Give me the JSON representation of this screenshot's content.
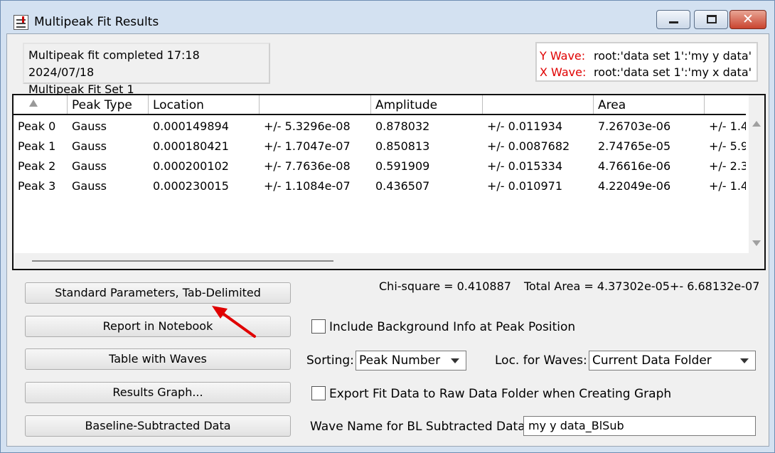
{
  "window": {
    "title": "Multipeak Fit Results",
    "close_glyph": "✕"
  },
  "status": {
    "line1": "Multipeak fit completed 17:18 2024/07/18",
    "line2": "Multipeak Fit Set 1"
  },
  "waves": {
    "y_label": "Y Wave:",
    "y_value": "root:'data set 1':'my y data'",
    "x_label": "X Wave:",
    "x_value": "root:'data set 1':'my x data'"
  },
  "table": {
    "headers": [
      "",
      "Peak Type",
      "Location",
      "",
      "Amplitude",
      "",
      "Area",
      ""
    ],
    "rows": [
      [
        "Peak 0",
        "Gauss",
        "0.000149894",
        "+/- 5.3296e-08",
        "0.878032",
        "+/- 0.011934",
        "7.26703e-06",
        "+/- 1.4"
      ],
      [
        "Peak 1",
        "Gauss",
        "0.000180421",
        "+/- 1.7047e-07",
        "0.850813",
        "+/- 0.0087682",
        "2.74765e-05",
        "+/- 5.9"
      ],
      [
        "Peak 2",
        "Gauss",
        "0.000200102",
        "+/- 7.7636e-08",
        "0.591909",
        "+/- 0.015334",
        "4.76616e-06",
        "+/- 2.3"
      ],
      [
        "Peak 3",
        "Gauss",
        "0.000230015",
        "+/- 1.1084e-07",
        "0.436507",
        "+/- 0.010971",
        "4.22049e-06",
        "+/- 1.4"
      ]
    ]
  },
  "stats": {
    "chi_square": "Chi-square = 0.410887",
    "total_area": "Total Area = 4.37302e-05+- 6.68132e-07"
  },
  "buttons": {
    "standard_params": "Standard Parameters, Tab-Delimited",
    "report_notebook": "Report in Notebook",
    "table_waves": "Table with Waves",
    "results_graph": "Results Graph...",
    "baseline_subtracted": "Baseline-Subtracted Data"
  },
  "options": {
    "include_background": "Include Background Info at Peak Position",
    "sorting_label": "Sorting:",
    "sorting_value": "Peak Number",
    "loc_label": "Loc. for Waves:",
    "loc_value": "Current Data Folder",
    "export_fit": "Export Fit Data to Raw Data Folder when Creating Graph",
    "bl_name_label": "Wave Name for BL Subtracted Data:",
    "bl_name_value": "my y data_BlSub"
  },
  "colors": {
    "wave_label": "#e00000",
    "annotation_arrow": "#e00000",
    "title_bg": "#d3e1f1"
  }
}
